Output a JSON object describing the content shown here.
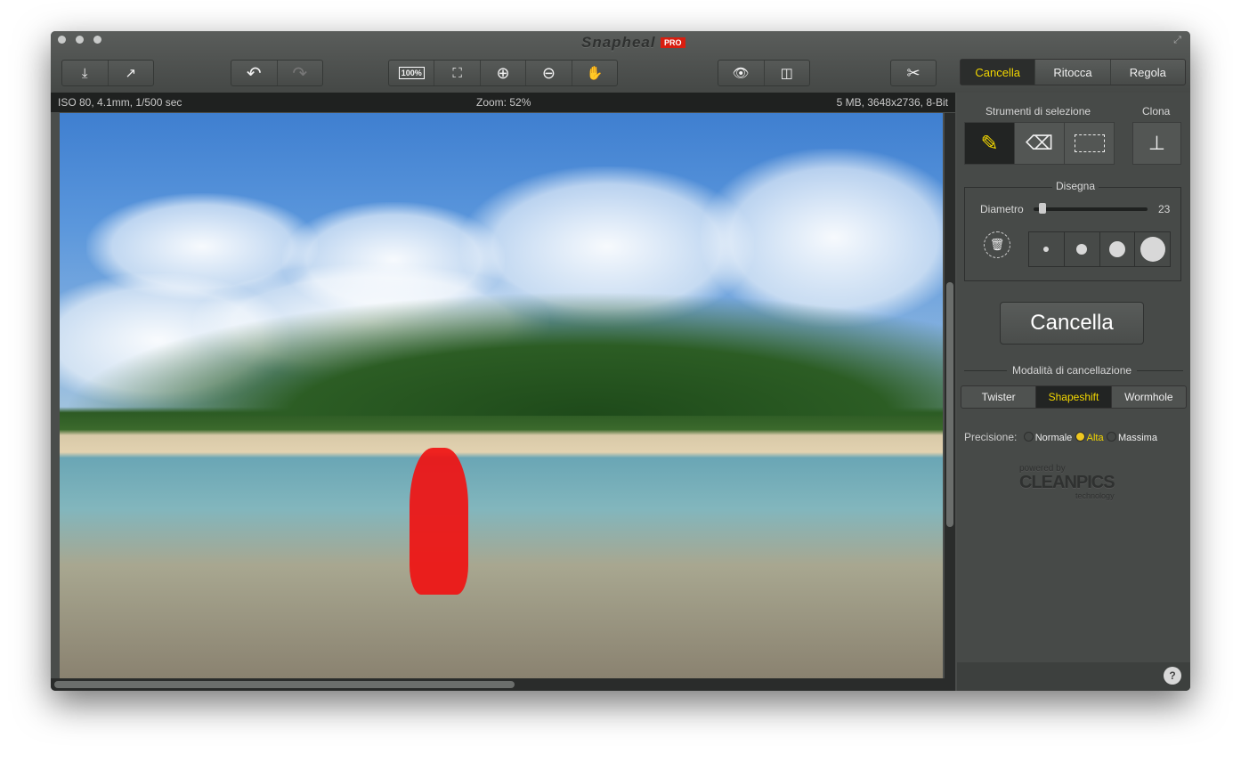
{
  "app": {
    "title": "Snapheal",
    "badge": "PRO"
  },
  "toolbar": {
    "import": "⤓",
    "export": "↗",
    "undo": "↶",
    "redo": "↷",
    "actual_size": "100%",
    "fit": "⛶",
    "zoom_in": "⊕",
    "zoom_out": "⊖",
    "pan": "✋",
    "preview": "👁",
    "compare": "◫",
    "crop": "✂"
  },
  "tabs": [
    {
      "label": "Cancella",
      "active": true
    },
    {
      "label": "Ritocca"
    },
    {
      "label": "Regola"
    }
  ],
  "info": {
    "exif": "ISO 80, 4.1mm, 1/500 sec",
    "zoom": "Zoom: 52%",
    "file": "5 MB, 3648x2736, 8-Bit"
  },
  "panel": {
    "selection_title": "Strumenti di selezione",
    "clone_title": "Clona",
    "draw_title": "Disegna",
    "diameter_label": "Diametro",
    "diameter_value": "23",
    "diameter_fraction": 0.05,
    "erase_button": "Cancella",
    "mode_title": "Modalità di cancellazione",
    "modes": [
      {
        "label": "Twister"
      },
      {
        "label": "Shapeshift",
        "active": true
      },
      {
        "label": "Wormhole"
      }
    ],
    "precision_label": "Precisione:",
    "precision": [
      {
        "label": "Normale"
      },
      {
        "label": "Alta",
        "selected": true
      },
      {
        "label": "Massima"
      }
    ],
    "powered_by": "powered by",
    "brand": "CLEANPICS",
    "brand_sub": "technology",
    "help": "?"
  },
  "colors": {
    "accent": "#f2d600",
    "mask": "#f01212"
  }
}
